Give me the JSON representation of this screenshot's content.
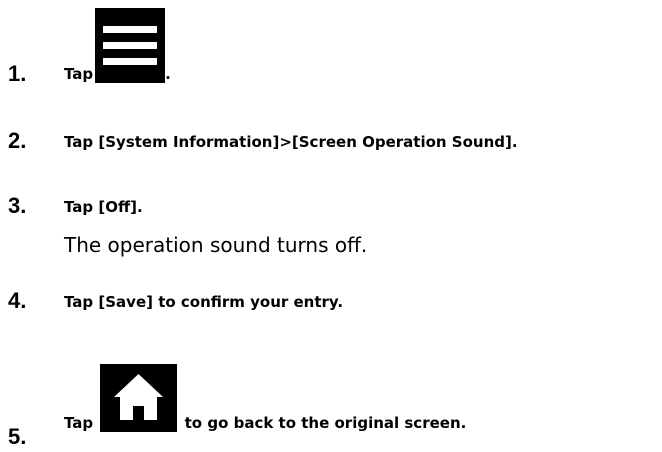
{
  "steps": [
    {
      "number": "1.",
      "text_before": "Tap",
      "icon": "hamburger-menu-icon",
      "text_after": "."
    },
    {
      "number": "2.",
      "text": "Tap [System Information]>[Screen Operation Sound]."
    },
    {
      "number": "3.",
      "text": "Tap [Off].",
      "result": "The operation sound turns off."
    },
    {
      "number": "4.",
      "text": "Tap [Save] to confirm your entry."
    },
    {
      "number": "5.",
      "text_before": "Tap",
      "icon": "home-icon",
      "text_after": "to go back to the original screen."
    }
  ],
  "colors": {
    "text": "#000000",
    "icon_background": "#000000",
    "icon_foreground": "#ffffff"
  }
}
